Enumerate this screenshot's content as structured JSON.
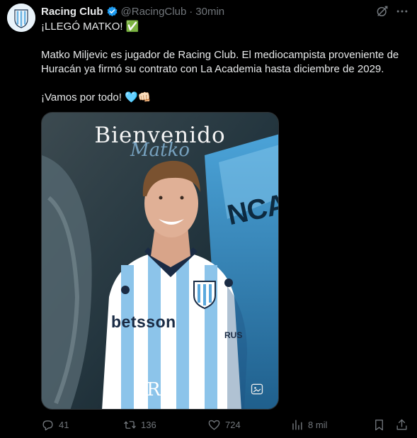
{
  "account": {
    "name": "Racing Club",
    "handle": "@RacingClub",
    "separator": "·",
    "time": "30min"
  },
  "post": {
    "line1": "¡LLEGÓ MATKO! ✅",
    "line2": "Matko Miljevic es jugador de Racing Club. El mediocampista proveniente de Huracán ya firmó su contrato con La Academia hasta diciembre de 2029.",
    "line3": "¡Vamos por todo! 🩵👊🏻"
  },
  "media": {
    "title": "Bienvenido",
    "subtitle": "Matko",
    "sponsor": "betsson",
    "sleeve_sponsor": "RUS",
    "wall_text": "NCA",
    "logo": "R"
  },
  "actions": {
    "replies": "41",
    "reposts": "136",
    "likes": "724",
    "views": "8 mil"
  },
  "icons": {
    "verified": "verified-badge-icon",
    "grok": "grok-icon",
    "more": "more-icon",
    "reply": "reply-icon",
    "repost": "repost-icon",
    "like": "heart-icon",
    "views": "views-icon",
    "bookmark": "bookmark-icon",
    "share": "share-icon"
  },
  "colors": {
    "background": "#000000",
    "text": "#e7e9ea",
    "secondary": "#71767b",
    "verified": "#1d9bf0"
  }
}
